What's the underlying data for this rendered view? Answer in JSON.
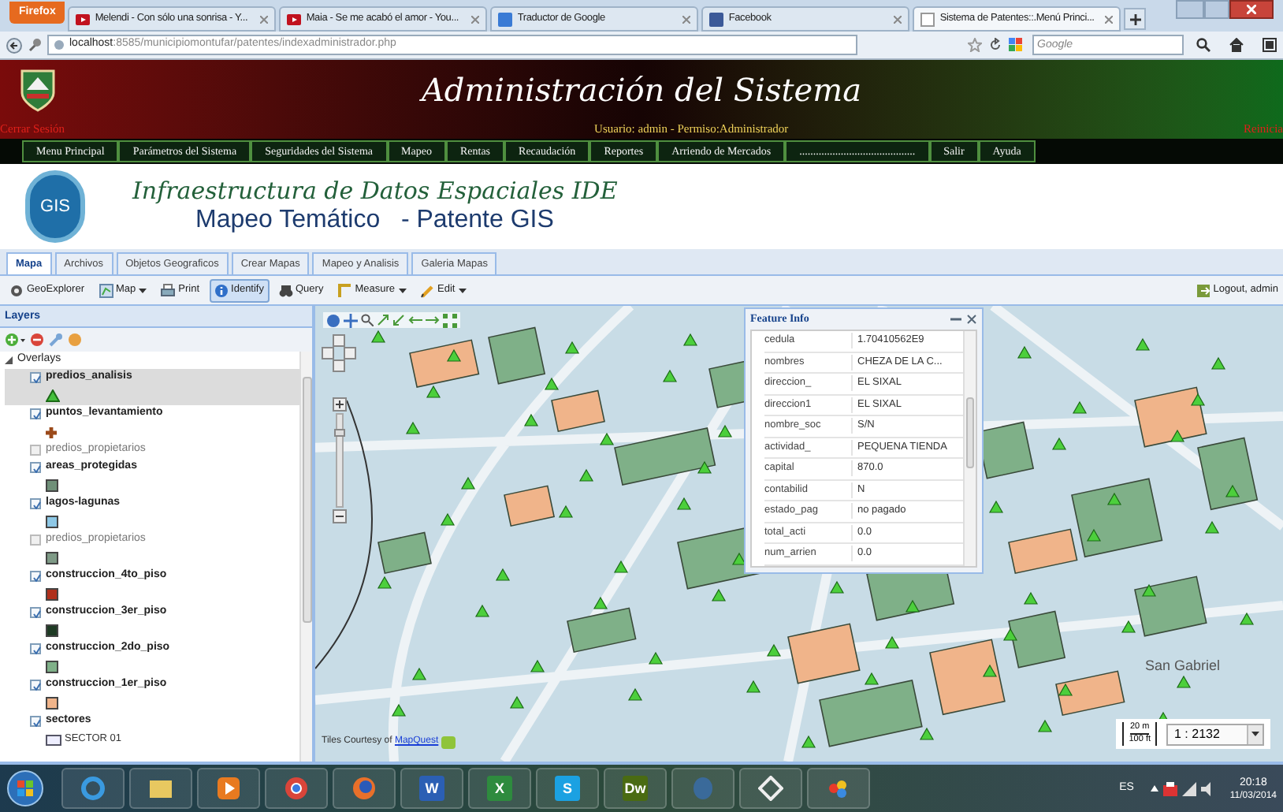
{
  "browser": {
    "menu_button": "Firefox",
    "tabs": [
      {
        "label": "Melendi - Con sólo una sonrisa - Y...",
        "selected": false,
        "kind": "video"
      },
      {
        "label": "Maia - Se me acabó el amor - You...",
        "selected": false,
        "kind": "video"
      },
      {
        "label": "Traductor de Google",
        "selected": false,
        "kind": "translate"
      },
      {
        "label": "Facebook",
        "selected": false,
        "kind": "social"
      },
      {
        "label": "Sistema de Patentes::.Menú Princi...",
        "selected": true,
        "kind": "page"
      }
    ],
    "url_host": "localhost",
    "url_rest": ":8585/municipiomontufar/patentes/indexadministrador.php",
    "search_placeholder": "Google"
  },
  "header": {
    "title": "Administración del Sistema",
    "logout": "Cerrar Sesión",
    "user": "Usuario: admin - Permiso:Administrador",
    "right": "Reinicia",
    "menu": [
      "Menu Principal",
      "Parámetros del Sistema",
      "Seguridades del Sistema",
      "Mapeo",
      "Rentas",
      "Recaudación",
      "Reportes",
      "Arriendo de Mercados",
      "..........................................",
      "Salir",
      "Ayuda"
    ]
  },
  "banner": {
    "logo": "GIS",
    "title": "Infraestructura de Datos Espaciales IDE",
    "subtitle": "Mapeo Temático   - Patente GIS"
  },
  "app_tabs": [
    {
      "label": "Mapa",
      "selected": true
    },
    {
      "label": "Archivos",
      "selected": false
    },
    {
      "label": "Objetos Geograficos",
      "selected": false
    },
    {
      "label": "Crear Mapas",
      "selected": false
    },
    {
      "label": "Mapeo y Analisis",
      "selected": false
    },
    {
      "label": "Galeria Mapas",
      "selected": false
    }
  ],
  "toolbar": {
    "items": [
      {
        "label": "GeoExplorer",
        "kind": "gear",
        "dropdown": false,
        "selected": false
      },
      {
        "label": "Map",
        "kind": "map",
        "dropdown": true,
        "selected": false
      },
      {
        "label": "Print",
        "kind": "print",
        "dropdown": false,
        "selected": false
      },
      {
        "label": "Identify",
        "kind": "info",
        "dropdown": false,
        "selected": true
      },
      {
        "label": "Query",
        "kind": "query",
        "dropdown": false,
        "selected": false
      },
      {
        "label": "Measure",
        "kind": "ruler",
        "dropdown": true,
        "selected": false
      },
      {
        "label": "Edit",
        "kind": "edit",
        "dropdown": true,
        "selected": false
      }
    ],
    "logout": "Logout, admin"
  },
  "layers": {
    "title": "Layers",
    "group": "Overlays",
    "items": [
      {
        "name": "predios_analisis",
        "checked": true,
        "selected": true,
        "kind": "triangle"
      },
      {
        "name": "puntos_levantamiento",
        "checked": true,
        "selected": false,
        "kind": "cross"
      },
      {
        "name": "predios_propietarios",
        "checked": false,
        "selected": false,
        "kind": "plain"
      },
      {
        "name": "areas_protegidas",
        "checked": true,
        "selected": false,
        "kind": "square",
        "color": "#6f8f78"
      },
      {
        "name": "lagos-lagunas",
        "checked": true,
        "selected": false,
        "kind": "square",
        "color": "#8ec8e6"
      },
      {
        "name": "predios_propietarios",
        "checked": false,
        "selected": false,
        "kind": "square",
        "color": "#7e9a86"
      },
      {
        "name": "construccion_4to_piso",
        "checked": true,
        "selected": false,
        "kind": "square",
        "color": "#b0301c"
      },
      {
        "name": "construccion_3er_piso",
        "checked": true,
        "selected": false,
        "kind": "square",
        "color": "#1e3b24"
      },
      {
        "name": "construccion_2do_piso",
        "checked": true,
        "selected": false,
        "kind": "square",
        "color": "#7fb088"
      },
      {
        "name": "construccion_1er_piso",
        "checked": true,
        "selected": false,
        "kind": "square",
        "color": "#f0b48a"
      },
      {
        "name": "sectores",
        "checked": true,
        "selected": false,
        "kind": "sub",
        "sub": "SECTOR 01"
      }
    ]
  },
  "feature_info": {
    "title": "Feature Info",
    "rows": [
      [
        "cedula",
        "1.70410562E9"
      ],
      [
        "nombres",
        "CHEZA DE LA C..."
      ],
      [
        "direccion_",
        "EL SIXAL"
      ],
      [
        "direccion1",
        "EL SIXAL"
      ],
      [
        "nombre_soc",
        "S/N"
      ],
      [
        "actividad_",
        "PEQUENA TIENDA"
      ],
      [
        "capital",
        "870.0"
      ],
      [
        "contabilid",
        "N"
      ],
      [
        "estado_pag",
        "no pagado"
      ],
      [
        "total_acti",
        "0.0"
      ],
      [
        "num_arrien",
        "0.0"
      ]
    ]
  },
  "map": {
    "zoom_slider": {
      "level": 0.85
    },
    "place": "San Gabriel",
    "attribution": "Tiles Courtesy of",
    "attribution_link": "MapQuest",
    "scale_metric": "20 m",
    "scale_imperial": "100 ft",
    "scale": "1 : 2132"
  },
  "taskbar": {
    "items": [
      {
        "kind": "ie"
      },
      {
        "kind": "folder"
      },
      {
        "kind": "media"
      },
      {
        "kind": "chrome"
      },
      {
        "kind": "firefox"
      },
      {
        "kind": "tile",
        "label": "W",
        "color": "#2b5fb4"
      },
      {
        "kind": "tile",
        "label": "X",
        "color": "#2e8b3e"
      },
      {
        "kind": "tile",
        "label": "S",
        "color": "#1ba1e2"
      },
      {
        "kind": "tile",
        "label": "Dw",
        "color": "#4a6b12"
      },
      {
        "kind": "elephant"
      },
      {
        "kind": "diamond"
      },
      {
        "kind": "paint"
      }
    ],
    "language": "ES",
    "time": "20:18",
    "date": "11/03/2014"
  }
}
